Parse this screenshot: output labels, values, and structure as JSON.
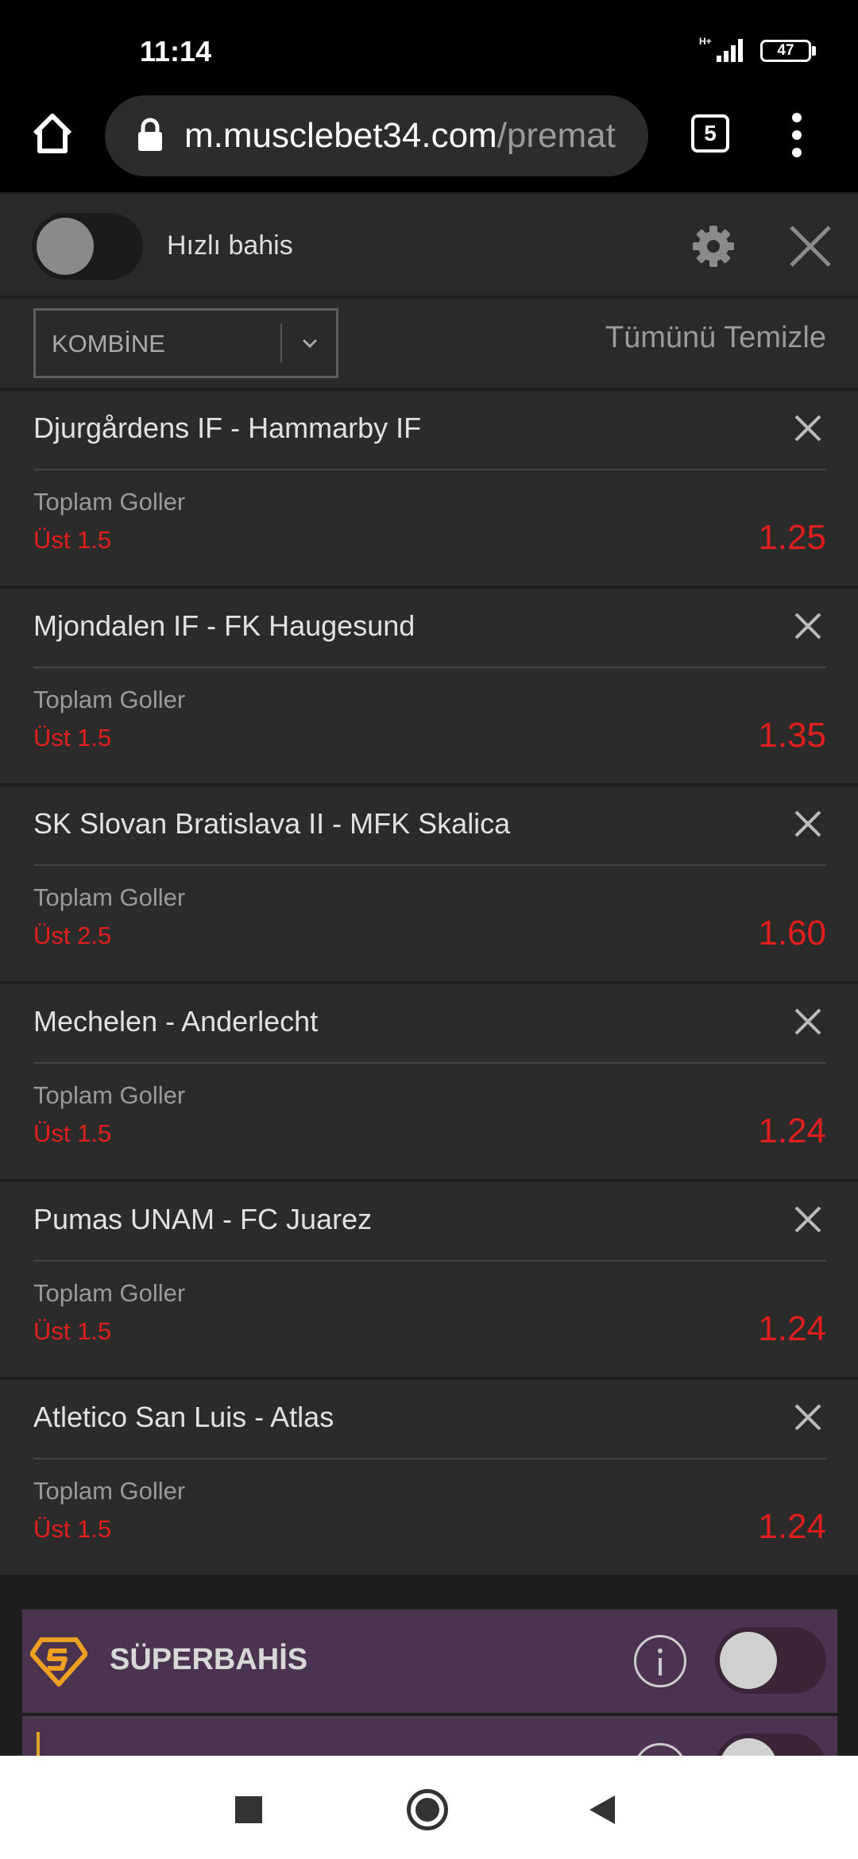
{
  "status_bar": {
    "time": "11:14",
    "network": "H+",
    "battery": "47"
  },
  "browser": {
    "url_domain": "m.musclebet34.com",
    "url_path": "/premat",
    "tab_count": "5"
  },
  "betslip": {
    "quick_bet_label": "Hızlı bahis",
    "bet_type": "KOMBİNE",
    "clear_all_label": "Tümünü Temizle",
    "bets": [
      {
        "match": "Djurgårdens IF - Hammarby IF",
        "market": "Toplam Goller",
        "selection": "Üst 1.5",
        "odds": "1.25"
      },
      {
        "match": "Mjondalen IF - FK Haugesund",
        "market": "Toplam Goller",
        "selection": "Üst 1.5",
        "odds": "1.35"
      },
      {
        "match": "SK Slovan Bratislava II - MFK Skalica",
        "market": "Toplam Goller",
        "selection": "Üst 2.5",
        "odds": "1.60"
      },
      {
        "match": "Mechelen - Anderlecht",
        "market": "Toplam Goller",
        "selection": "Üst 1.5",
        "odds": "1.24"
      },
      {
        "match": "Pumas UNAM - FC Juarez",
        "market": "Toplam Goller",
        "selection": "Üst 1.5",
        "odds": "1.24"
      },
      {
        "match": "Atletico San Luis - Atlas",
        "market": "Toplam Goller",
        "selection": "Üst 1.5",
        "odds": "1.24"
      }
    ],
    "superbahis_label": "SÜPERBAHİS"
  },
  "colors": {
    "odds": "#e21e1e",
    "panel": "#2b2b2b",
    "superbahis_bg": "#4a3450",
    "superbahis_logo": "#f0a020"
  }
}
